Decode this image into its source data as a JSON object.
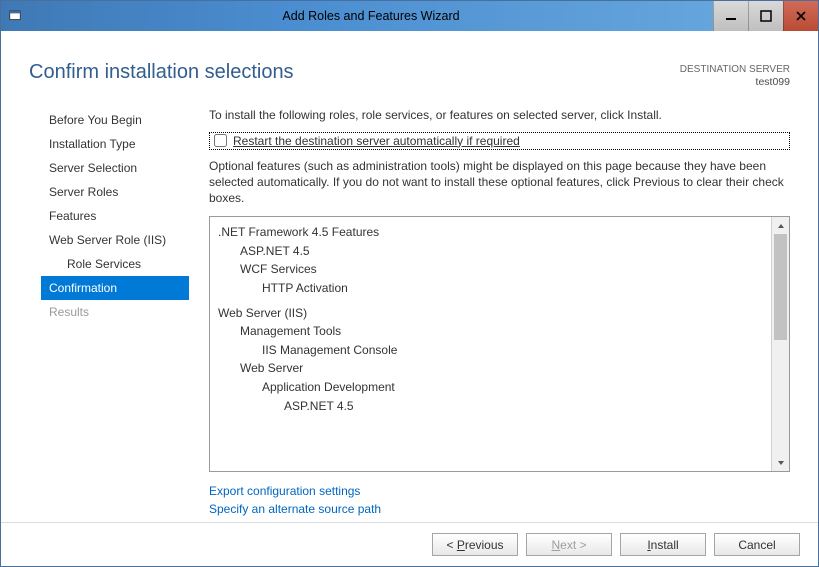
{
  "window": {
    "title": "Add Roles and Features Wizard"
  },
  "header": {
    "page_title": "Confirm installation selections",
    "dest_label": "DESTINATION SERVER",
    "dest_value": "test099"
  },
  "sidebar": {
    "items": [
      {
        "label": "Before You Begin"
      },
      {
        "label": "Installation Type"
      },
      {
        "label": "Server Selection"
      },
      {
        "label": "Server Roles"
      },
      {
        "label": "Features"
      },
      {
        "label": "Web Server Role (IIS)"
      },
      {
        "label": "Role Services"
      },
      {
        "label": "Confirmation"
      },
      {
        "label": "Results"
      }
    ]
  },
  "content": {
    "prompt": "To install the following roles, role services, or features on selected server, click Install.",
    "restart_label": "Restart the destination server automatically if required",
    "note": "Optional features (such as administration tools) might be displayed on this page because they have been selected automatically. If you do not want to install these optional features, click Previous to clear their check boxes.",
    "tree": {
      "a": ".NET Framework 4.5 Features",
      "a1": "ASP.NET 4.5",
      "a2": "WCF Services",
      "a2a": "HTTP Activation",
      "b": "Web Server (IIS)",
      "b1": "Management Tools",
      "b1a": "IIS Management Console",
      "b2": "Web Server",
      "b2a": "Application Development",
      "b2a1": "ASP.NET 4.5"
    },
    "link_export": "Export configuration settings",
    "link_source": "Specify an alternate source path"
  },
  "footer": {
    "previous_html": "< <span class='ak'>P</span>revious",
    "next_html": "<span class='ak'>N</span>ext >",
    "install_html": "<span class='ak'>I</span>nstall",
    "cancel": "Cancel"
  }
}
